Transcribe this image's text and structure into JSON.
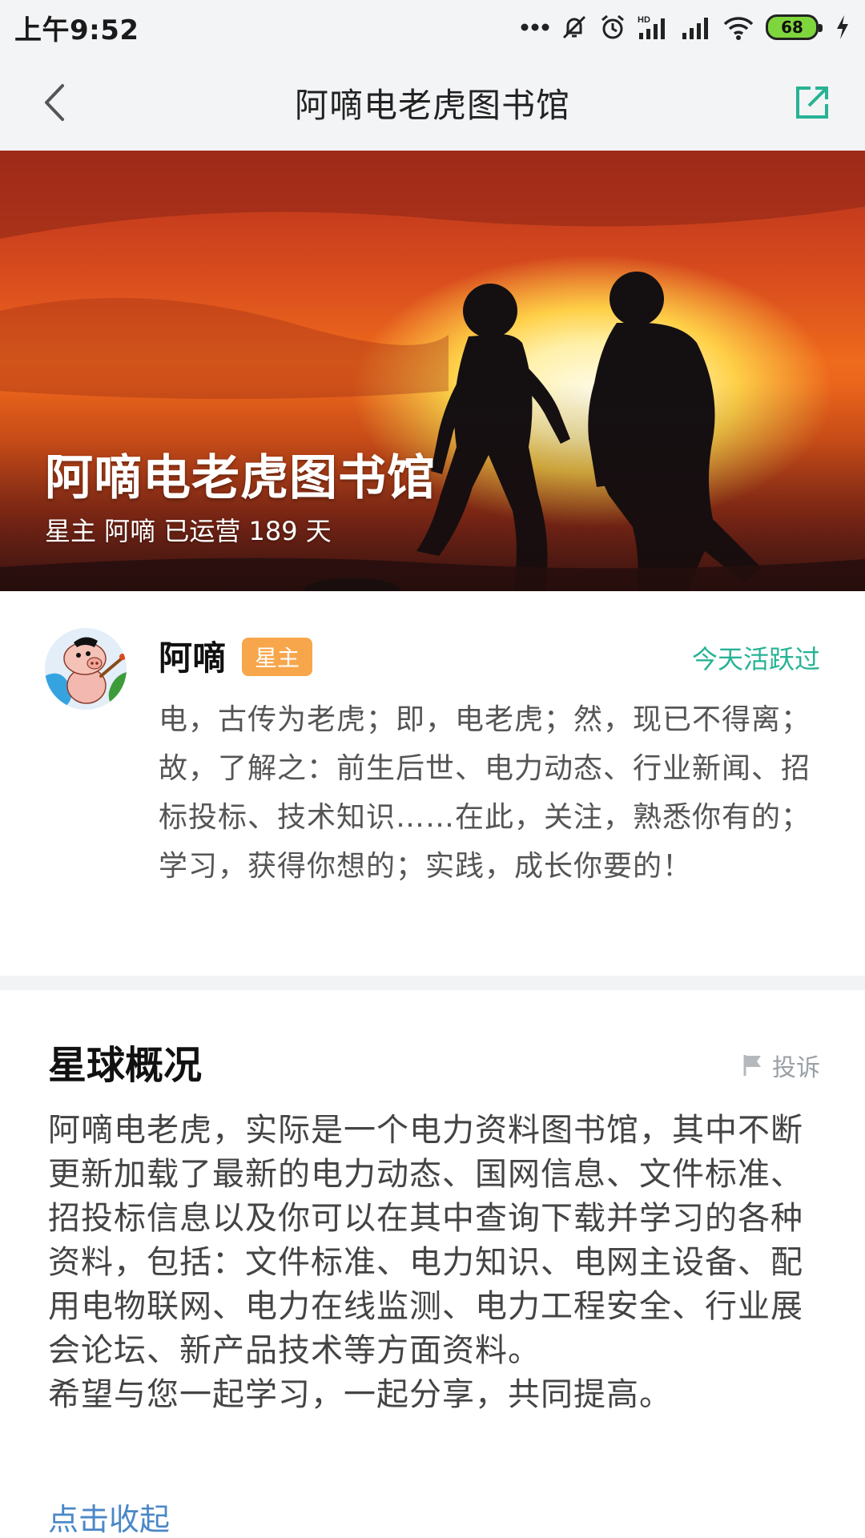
{
  "status_bar": {
    "time": "上午9:52",
    "battery": "68",
    "icons": [
      "more-dots-icon",
      "mute-icon",
      "alarm-icon",
      "hd-signal-icon",
      "signal-icon",
      "wifi-icon",
      "battery-icon",
      "charging-icon"
    ]
  },
  "nav": {
    "title": "阿嘀电老虎图书馆",
    "back_icon": "chevron-left-icon",
    "share_icon": "share-external-icon",
    "accent": "#27b394"
  },
  "banner": {
    "title": "阿嘀电老虎图书馆",
    "subtitle": "星主 阿嘀 已运营 189 天"
  },
  "owner": {
    "name": "阿嘀",
    "badge": "星主",
    "badge_color": "#f7a64b",
    "activity": "今天活跃过",
    "description": "电，古传为老虎；即，电老虎；然，现已不得离；故，了解之：前生后世、电力动态、行业新闻、招标投标、技术知识……在此，关注，熟悉你有的；学习，获得你想的；实践，成长你要的！"
  },
  "overview": {
    "title": "星球概况",
    "report_label": "投诉",
    "paragraph1": "阿嘀电老虎，实际是一个电力资料图书馆，其中不断更新加载了最新的电力动态、国网信息、文件标准、招投标信息以及你可以在其中查询下载并学习的各种资料，包括：文件标准、电力知识、电网主设备、配用电物联网、电力在线监测、电力工程安全、行业展会论坛、新产品技术等方面资料。",
    "paragraph2": "希望与您一起学习，一起分享，共同提高。",
    "collapse_label": "点击收起",
    "link_color": "#4a87c7"
  }
}
